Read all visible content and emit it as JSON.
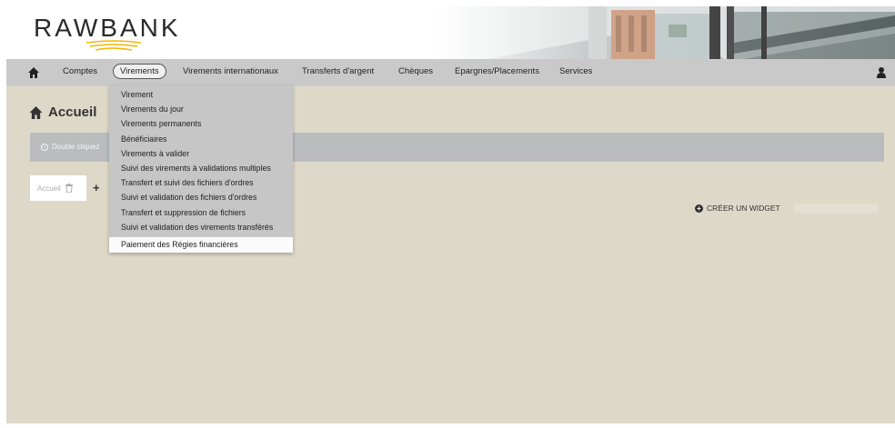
{
  "brand": {
    "name": "RAWBANK",
    "accent": "#f2b705"
  },
  "navbar": {
    "home_icon": "home-icon",
    "items": [
      {
        "label": "Comptes"
      },
      {
        "label": "Virements"
      },
      {
        "label": "Virements internationaux"
      },
      {
        "label": "Transferts d'argent"
      },
      {
        "label": "Chèques"
      },
      {
        "label": "Epargnes/Placements"
      },
      {
        "label": "Services"
      }
    ],
    "active": "Virements",
    "user_icon": "user-icon"
  },
  "dropdown": {
    "items": [
      {
        "label": "Virement"
      },
      {
        "label": "Virements du jour"
      },
      {
        "label": "Virements permanents"
      },
      {
        "label": "Bénéficiaires"
      },
      {
        "label": "Virements à valider"
      },
      {
        "label": "Suivi des virements à validations multiples"
      },
      {
        "label": "Transfert et suivi des fichiers d'ordres"
      },
      {
        "label": "Suivi et validation des fichiers d'ordres"
      },
      {
        "label": "Transfert et suppression de fichiers"
      },
      {
        "label": "Suivi et validation des virements transférés"
      },
      {
        "label": "Paiement des Régies financières"
      }
    ],
    "highlighted": "Paiement des Régies financières"
  },
  "main": {
    "title": "Accueil",
    "info_text": "Double cliquez",
    "tab_label": "Accueil",
    "tab_add": "+",
    "create_widget": "CRÉER UN WIDGET"
  }
}
